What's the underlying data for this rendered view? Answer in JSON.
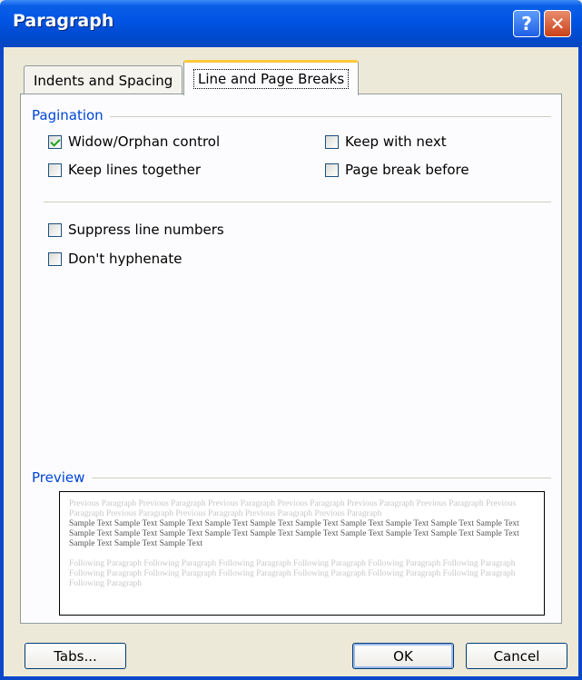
{
  "window": {
    "title": "Paragraph",
    "help_label": "?",
    "close_label": "✕"
  },
  "tabs": [
    {
      "label": "Indents and Spacing",
      "selected": false
    },
    {
      "label": "Line and Page Breaks",
      "selected": true
    }
  ],
  "pagination": {
    "label": "Pagination",
    "widow_orphan": {
      "label": "Widow/Orphan control",
      "checked": true
    },
    "keep_with_next": {
      "label": "Keep with next",
      "checked": false
    },
    "keep_lines_together": {
      "label": "Keep lines together",
      "checked": false
    },
    "page_break_before": {
      "label": "Page break before",
      "checked": false
    }
  },
  "formatting": {
    "suppress_line_numbers": {
      "label": "Suppress line numbers",
      "checked": false
    },
    "dont_hyphenate": {
      "label": "Don't hyphenate",
      "checked": false
    }
  },
  "preview": {
    "label": "Preview",
    "previous_text": "Previous Paragraph Previous Paragraph Previous Paragraph Previous Paragraph Previous Paragraph Previous Paragraph Previous Paragraph Previous Paragraph Previous Paragraph Previous Paragraph Previous Paragraph",
    "sample_text": "Sample Text Sample Text Sample Text Sample Text Sample Text Sample Text Sample Text Sample Text Sample Text Sample Text Sample Text Sample Text Sample Text Sample Text Sample Text Sample Text Sample Text Sample Text Sample Text Sample Text Sample Text Sample Text Sample Text",
    "following_text": "Following Paragraph Following Paragraph Following Paragraph Following Paragraph Following Paragraph Following Paragraph Following Paragraph Following Paragraph Following Paragraph Following Paragraph Following Paragraph Following Paragraph Following Paragraph"
  },
  "buttons": {
    "tabs": "Tabs...",
    "ok": "OK",
    "cancel": "Cancel"
  },
  "colors": {
    "titlebar": "#0054e3",
    "group_label": "#0046d5",
    "dialog_bg": "#ece9d8",
    "tab_highlight": "#ffc83c"
  }
}
